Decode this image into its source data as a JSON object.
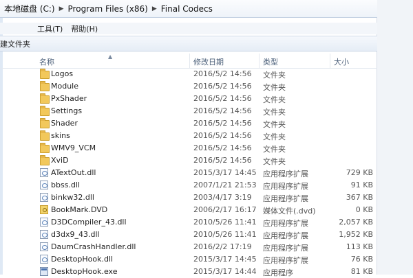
{
  "address": {
    "crumbs": [
      "本地磁盘 (C:)",
      "Program Files (x86)",
      "Final Codecs"
    ],
    "separator_icon": "chevron-right-icon"
  },
  "menu": {
    "tools": "工具(T)",
    "help": "帮助(H)"
  },
  "toolbar": {
    "new_folder": "建文件夹"
  },
  "columns": {
    "name": "名称",
    "date": "修改日期",
    "type": "类型",
    "size": "大小"
  },
  "files": [
    {
      "name": "Logos",
      "date": "2016/5/2 14:56",
      "type": "文件夹",
      "size": "",
      "icon": "folder-icon"
    },
    {
      "name": "Module",
      "date": "2016/5/2 14:56",
      "type": "文件夹",
      "size": "",
      "icon": "folder-icon"
    },
    {
      "name": "PxShader",
      "date": "2016/5/2 14:56",
      "type": "文件夹",
      "size": "",
      "icon": "folder-icon"
    },
    {
      "name": "Settings",
      "date": "2016/5/2 14:56",
      "type": "文件夹",
      "size": "",
      "icon": "folder-icon"
    },
    {
      "name": "Shader",
      "date": "2016/5/2 14:56",
      "type": "文件夹",
      "size": "",
      "icon": "folder-icon"
    },
    {
      "name": "skins",
      "date": "2016/5/2 14:56",
      "type": "文件夹",
      "size": "",
      "icon": "folder-icon"
    },
    {
      "name": "WMV9_VCM",
      "date": "2016/5/2 14:56",
      "type": "文件夹",
      "size": "",
      "icon": "folder-icon"
    },
    {
      "name": "XviD",
      "date": "2016/5/2 14:56",
      "type": "文件夹",
      "size": "",
      "icon": "folder-icon"
    },
    {
      "name": "ATextOut.dll",
      "date": "2015/3/17 14:45",
      "type": "应用程序扩展",
      "size": "729 KB",
      "icon": "dll-icon"
    },
    {
      "name": "bbss.dll",
      "date": "2007/1/21 21:53",
      "type": "应用程序扩展",
      "size": "91 KB",
      "icon": "dll-icon"
    },
    {
      "name": "binkw32.dll",
      "date": "2003/4/17 3:19",
      "type": "应用程序扩展",
      "size": "367 KB",
      "icon": "dll-icon"
    },
    {
      "name": "BookMark.DVD",
      "date": "2006/2/17 16:17",
      "type": "媒体文件(.dvd)",
      "size": "0 KB",
      "icon": "dvd-icon"
    },
    {
      "name": "D3DCompiler_43.dll",
      "date": "2010/5/26 11:41",
      "type": "应用程序扩展",
      "size": "2,057 KB",
      "icon": "dll-icon"
    },
    {
      "name": "d3dx9_43.dll",
      "date": "2010/5/26 11:41",
      "type": "应用程序扩展",
      "size": "1,952 KB",
      "icon": "dll-icon"
    },
    {
      "name": "DaumCrashHandler.dll",
      "date": "2016/2/2 17:19",
      "type": "应用程序扩展",
      "size": "113 KB",
      "icon": "dll-icon"
    },
    {
      "name": "DesktopHook.dll",
      "date": "2015/3/17 14:45",
      "type": "应用程序扩展",
      "size": "76 KB",
      "icon": "dll-icon"
    },
    {
      "name": "DesktopHook.exe",
      "date": "2015/3/17 14:44",
      "type": "应用程序",
      "size": "81 KB",
      "icon": "exe-icon"
    }
  ]
}
